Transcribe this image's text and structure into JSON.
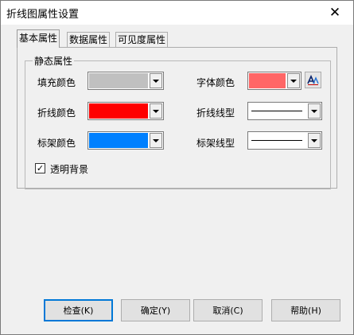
{
  "window": {
    "title": "折线图属性设置",
    "close_glyph": "✕"
  },
  "tabs": [
    {
      "label": "基本属性",
      "active": true
    },
    {
      "label": "数据属性",
      "active": false
    },
    {
      "label": "可见度属性",
      "active": false
    }
  ],
  "group": {
    "label": "静态属性",
    "fill_color": {
      "label": "填充颜色",
      "value": "#c0c0c0"
    },
    "line_color": {
      "label": "折线颜色",
      "value": "#ff0000"
    },
    "frame_color": {
      "label": "标架颜色",
      "value": "#0080ff"
    },
    "font_color": {
      "label": "字体颜色",
      "value": "#ff6666"
    },
    "line_style": {
      "label": "折线线型",
      "value": "solid"
    },
    "frame_style": {
      "label": "标架线型",
      "value": "solid"
    },
    "transparent": {
      "label": "透明背景",
      "checked": true
    }
  },
  "buttons": {
    "check": "检查(K)",
    "ok": "确定(Y)",
    "cancel": "取消(C)",
    "help": "帮助(H)"
  }
}
